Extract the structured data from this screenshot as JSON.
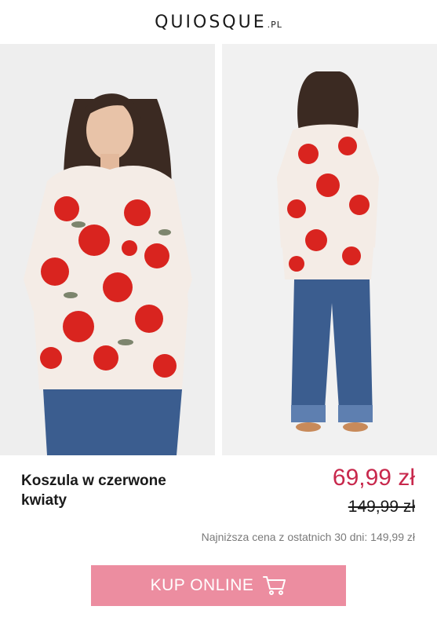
{
  "brand": {
    "name": "QUIOSQUE",
    "suffix": ".PL"
  },
  "images": [
    {
      "name": "front-photo",
      "alt": ""
    },
    {
      "name": "back-photo",
      "alt": ""
    }
  ],
  "product": {
    "title": "Koszula w czerwone kwiaty",
    "price": "69,99 zł",
    "old_price": "149,99 zł",
    "lowest_price_note": "Najniższa cena z ostatnich 30 dni: 149,99 zł"
  },
  "cta": {
    "label": "KUP ONLINE",
    "icon": "cart-icon"
  },
  "colors": {
    "price": "#c8284c",
    "cta_bg": "#ec8da0",
    "cta_text": "#ffffff"
  }
}
